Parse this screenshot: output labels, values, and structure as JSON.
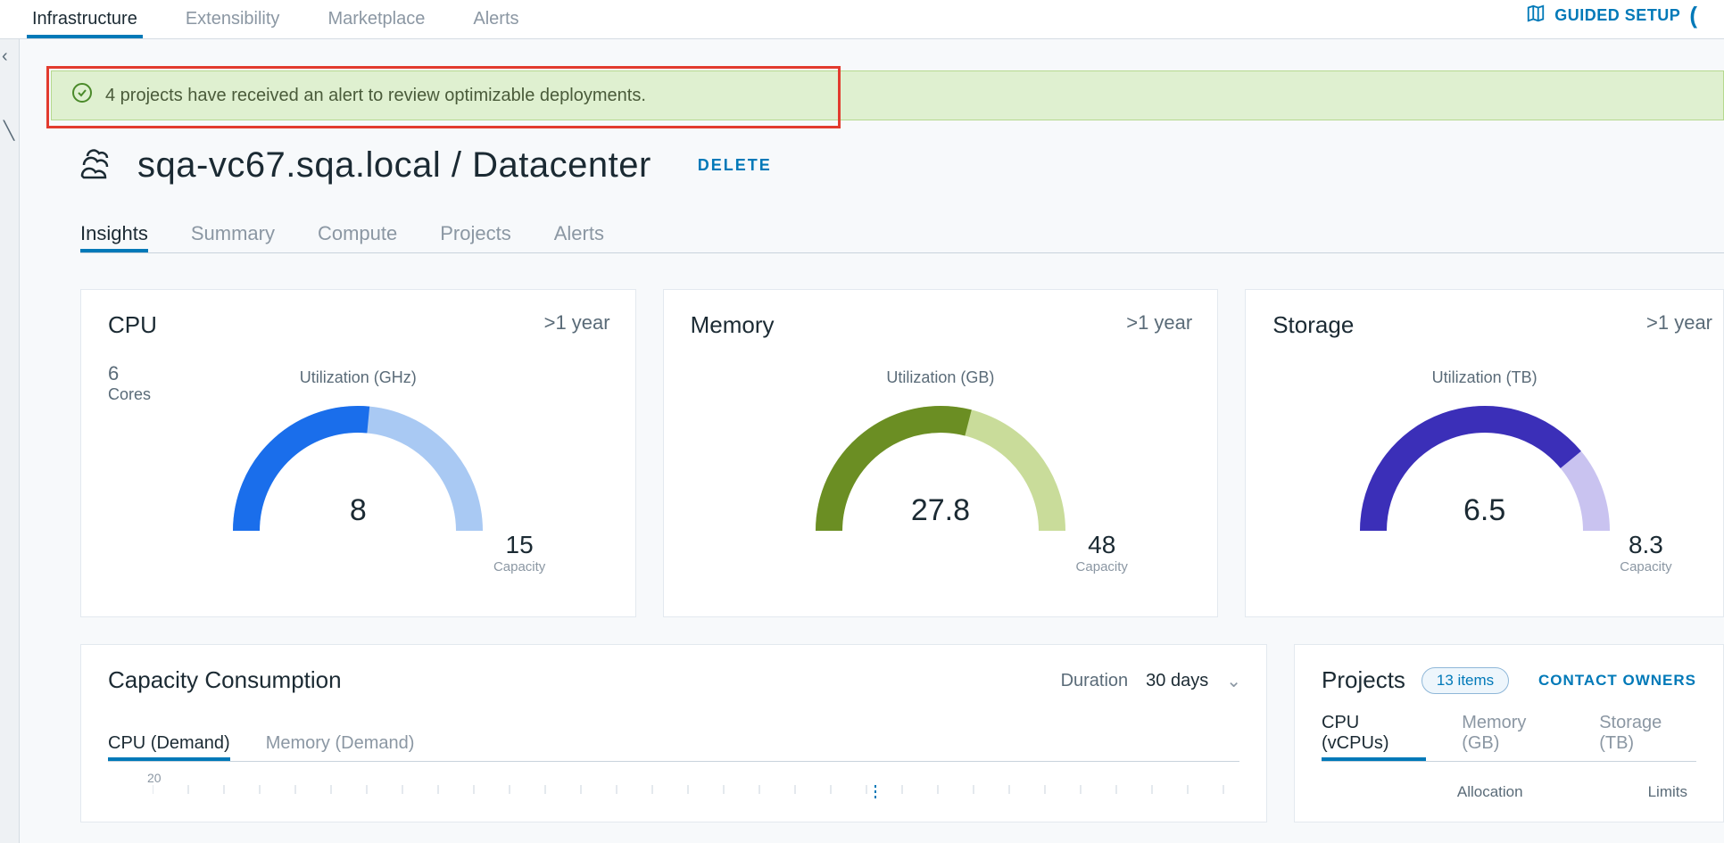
{
  "topnav": {
    "tabs": [
      "Infrastructure",
      "Extensibility",
      "Marketplace",
      "Alerts"
    ],
    "active": 0,
    "guided": "GUIDED SETUP"
  },
  "alert": {
    "text": "4 projects have received an alert to review optimizable deployments."
  },
  "title": {
    "breadcrumb": "sqa-vc67.sqa.local / Datacenter",
    "delete": "DELETE"
  },
  "subtabs": {
    "items": [
      "Insights",
      "Summary",
      "Compute",
      "Projects",
      "Alerts"
    ],
    "active": 0
  },
  "gauges": {
    "cpu": {
      "title": "CPU",
      "badge": ">1 year",
      "cores_value": "6",
      "cores_label": "Cores",
      "util_label": "Utilization (GHz)",
      "value": "8",
      "capacity": "15",
      "cap_label": "Capacity",
      "fill_pct": 53,
      "fg": "#1a6eeb",
      "bg": "#a9c9f3"
    },
    "memory": {
      "title": "Memory",
      "badge": ">1 year",
      "util_label": "Utilization (GB)",
      "value": "27.8",
      "capacity": "48",
      "cap_label": "Capacity",
      "fill_pct": 58,
      "fg": "#6b8e23",
      "bg": "#c9dc9a"
    },
    "storage": {
      "title": "Storage",
      "badge": ">1 year",
      "util_label": "Utilization (TB)",
      "value": "6.5",
      "capacity": "8.3",
      "cap_label": "Capacity",
      "fill_pct": 78,
      "fg": "#3b2fb8",
      "bg": "#c9c3f0"
    }
  },
  "capacity": {
    "title": "Capacity Consumption",
    "duration_label": "Duration",
    "duration_value": "30 days",
    "tabs": [
      "CPU (Demand)",
      "Memory (Demand)"
    ],
    "active": 0,
    "y_tick": "20"
  },
  "projects": {
    "title": "Projects",
    "pill": "13 items",
    "contact": "CONTACT OWNERS",
    "tabs": [
      "CPU (vCPUs)",
      "Memory (GB)",
      "Storage (TB)"
    ],
    "active": 0,
    "col_alloc": "Allocation",
    "col_limits": "Limits"
  },
  "chart_data": [
    {
      "type": "gauge",
      "title": "CPU Utilization (GHz)",
      "value": 8,
      "capacity": 15,
      "extra": {
        "cores": 6
      },
      "horizon": ">1 year"
    },
    {
      "type": "gauge",
      "title": "Memory Utilization (GB)",
      "value": 27.8,
      "capacity": 48,
      "horizon": ">1 year"
    },
    {
      "type": "gauge",
      "title": "Storage Utilization (TB)",
      "value": 6.5,
      "capacity": 8.3,
      "horizon": ">1 year"
    },
    {
      "type": "line",
      "title": "Capacity Consumption — CPU (Demand)",
      "duration_days": 30,
      "ylim": [
        0,
        20
      ],
      "series": []
    }
  ]
}
